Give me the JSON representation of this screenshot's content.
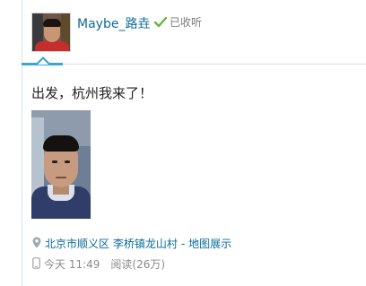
{
  "header": {
    "username": "Maybe_路垚",
    "listened_label": "已收听",
    "accent_color": "#3aa6d8",
    "link_color": "#0a6b99"
  },
  "post": {
    "text": "出发，杭州我来了！",
    "location": {
      "place": "北京市顺义区 李桥镇龙山村",
      "separator": "-",
      "map_link": "地图展示"
    },
    "meta": {
      "time": "今天 11:49",
      "reads": "阅读(26万)"
    }
  },
  "icons": {
    "check": "check-icon",
    "location": "location-pin-icon",
    "mobile": "mobile-icon"
  }
}
